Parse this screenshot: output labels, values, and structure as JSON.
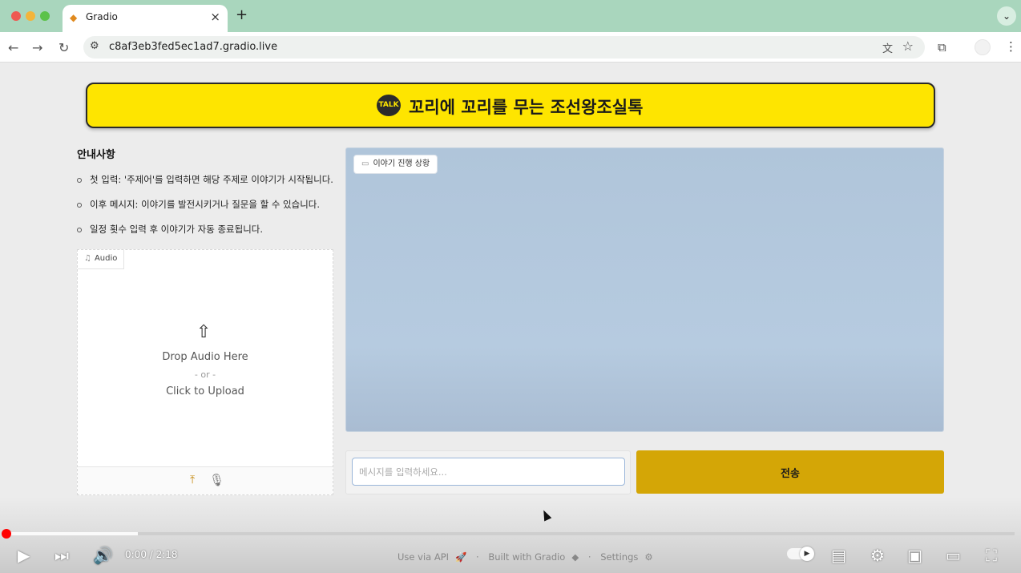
{
  "browser": {
    "tab_title": "Gradio",
    "tab_close": "×",
    "new_tab": "+",
    "url": "c8af3eb3fed5ec1ad7.gradio.live"
  },
  "banner": {
    "badge": "TALK",
    "title": "꼬리에 꼬리를 무는 조선왕조실톡",
    "bg_color": "#fee500"
  },
  "notice": {
    "title": "안내사항",
    "items": [
      "첫 입력: '주제어'를 입력하면 해당 주제로 이야기가 시작됩니다.",
      "이후 메시지: 이야기를 발전시키거나 질문을 할 수 있습니다.",
      "일정 횟수 입력 후 이야기가 자동 종료됩니다."
    ]
  },
  "audio": {
    "label": "Audio",
    "drop_text": "Drop Audio Here",
    "or_text": "- or -",
    "click_text": "Click to Upload"
  },
  "chat": {
    "label": "이야기 진행 상황"
  },
  "input": {
    "value": "",
    "placeholder": "메시지를 입력하세요..."
  },
  "send_button": {
    "label": "전송",
    "color": "#d4a606"
  },
  "footer": {
    "api": "Use via API",
    "built": "Built with Gradio",
    "settings": "Settings"
  },
  "player": {
    "time": "0:00 / 2:18",
    "progress_fraction": 0.0,
    "buffered_fraction": 0.13
  }
}
